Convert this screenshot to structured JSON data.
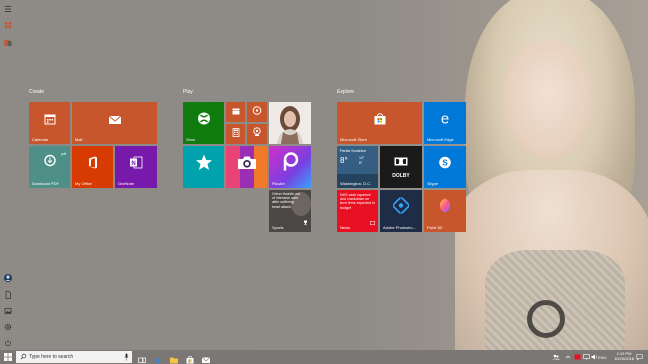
{
  "groups": {
    "create": "Create",
    "play": "Play",
    "explore": "Explore"
  },
  "tiles": {
    "calendar": "Calendar",
    "mail": "Mail",
    "download_pdf": "Download PDF",
    "my_office": "My Office",
    "onenote": "OneNote",
    "xbox": "Xbox",
    "picsart": "PicsArt",
    "sports_headline": "Glenn Hoddle out of intensive care after suffering heart attack",
    "sports": "Sports",
    "store": "Microsoft Store",
    "edge": "Microsoft Edge",
    "weather_condition": "Partial Sunshine",
    "weather_temp": "8°",
    "weather_high": "13°",
    "weather_low": "6°",
    "weather_city": "Washington, D.C.",
    "dolby": "DOLBY",
    "skype": "Skype",
    "news_headline": "NHS cash squeeze and crackdown on tech firms expected in budget",
    "news": "News",
    "photoshop": "Adobe Photosho...",
    "paint3d": "Paint 3D"
  },
  "taskbar": {
    "search_placeholder": "Type here to search",
    "lang": "ENG",
    "time": "2:19 PM",
    "date": "10/29/2018"
  },
  "colors": {
    "orange_tile": "#c8562c",
    "blue_tile": "#0078d7",
    "green_tile": "#107c10",
    "teal_tile": "#00a2ad",
    "purple_tile": "#7719aa",
    "office_red": "#d83b01",
    "news_red": "#e81123",
    "dark_tile": "#2a2a2a"
  }
}
